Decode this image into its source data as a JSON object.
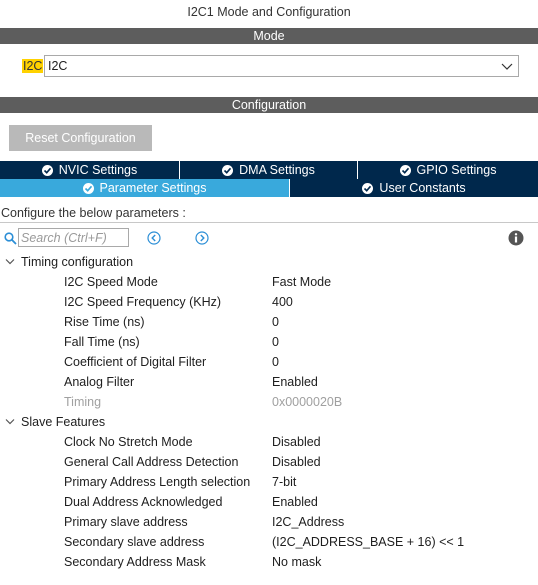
{
  "window": {
    "title": "I2C1 Mode and Configuration"
  },
  "mode": {
    "header": "Mode",
    "label": "I2C",
    "selected": "I2C"
  },
  "configuration": {
    "header": "Configuration",
    "reset_label": "Reset Configuration",
    "tabs_row1": [
      {
        "label": "NVIC Settings"
      },
      {
        "label": "DMA Settings"
      },
      {
        "label": "GPIO Settings"
      }
    ],
    "tabs_row2": [
      {
        "label": "Parameter Settings",
        "active": true
      },
      {
        "label": "User Constants",
        "active": false
      }
    ],
    "configure_text": "Configure the below parameters :",
    "search_placeholder": "Search (Ctrl+F)"
  },
  "groups": [
    {
      "name": "Timing configuration",
      "params": [
        {
          "name": "I2C Speed Mode",
          "value": "Fast Mode"
        },
        {
          "name": "I2C Speed Frequency (KHz)",
          "value": "400"
        },
        {
          "name": "Rise Time (ns)",
          "value": "0"
        },
        {
          "name": "Fall Time (ns)",
          "value": "0"
        },
        {
          "name": "Coefficient of Digital Filter",
          "value": "0"
        },
        {
          "name": "Analog Filter",
          "value": "Enabled"
        },
        {
          "name": "Timing",
          "value": "0x0000020B"
        }
      ]
    },
    {
      "name": "Slave Features",
      "params": [
        {
          "name": "Clock No Stretch Mode",
          "value": "Disabled"
        },
        {
          "name": "General Call Address Detection",
          "value": "Disabled"
        },
        {
          "name": "Primary Address Length selection",
          "value": "7-bit"
        },
        {
          "name": "Dual Address Acknowledged",
          "value": "Enabled"
        },
        {
          "name": "Primary slave address",
          "value": "I2C_Address"
        },
        {
          "name": "Secondary slave address",
          "value": "(I2C_ADDRESS_BASE + 16) << 1"
        },
        {
          "name": "Secondary Address Mask",
          "value": "No mask"
        }
      ]
    }
  ],
  "colors": {
    "header_band": "#5d5d5d",
    "tab_dark": "#00284c",
    "tab_active": "#39a9dc",
    "mode_highlight": "#ffd200",
    "reset_button": "#b9b9b9",
    "disabled_text": "#a0a0a0"
  }
}
